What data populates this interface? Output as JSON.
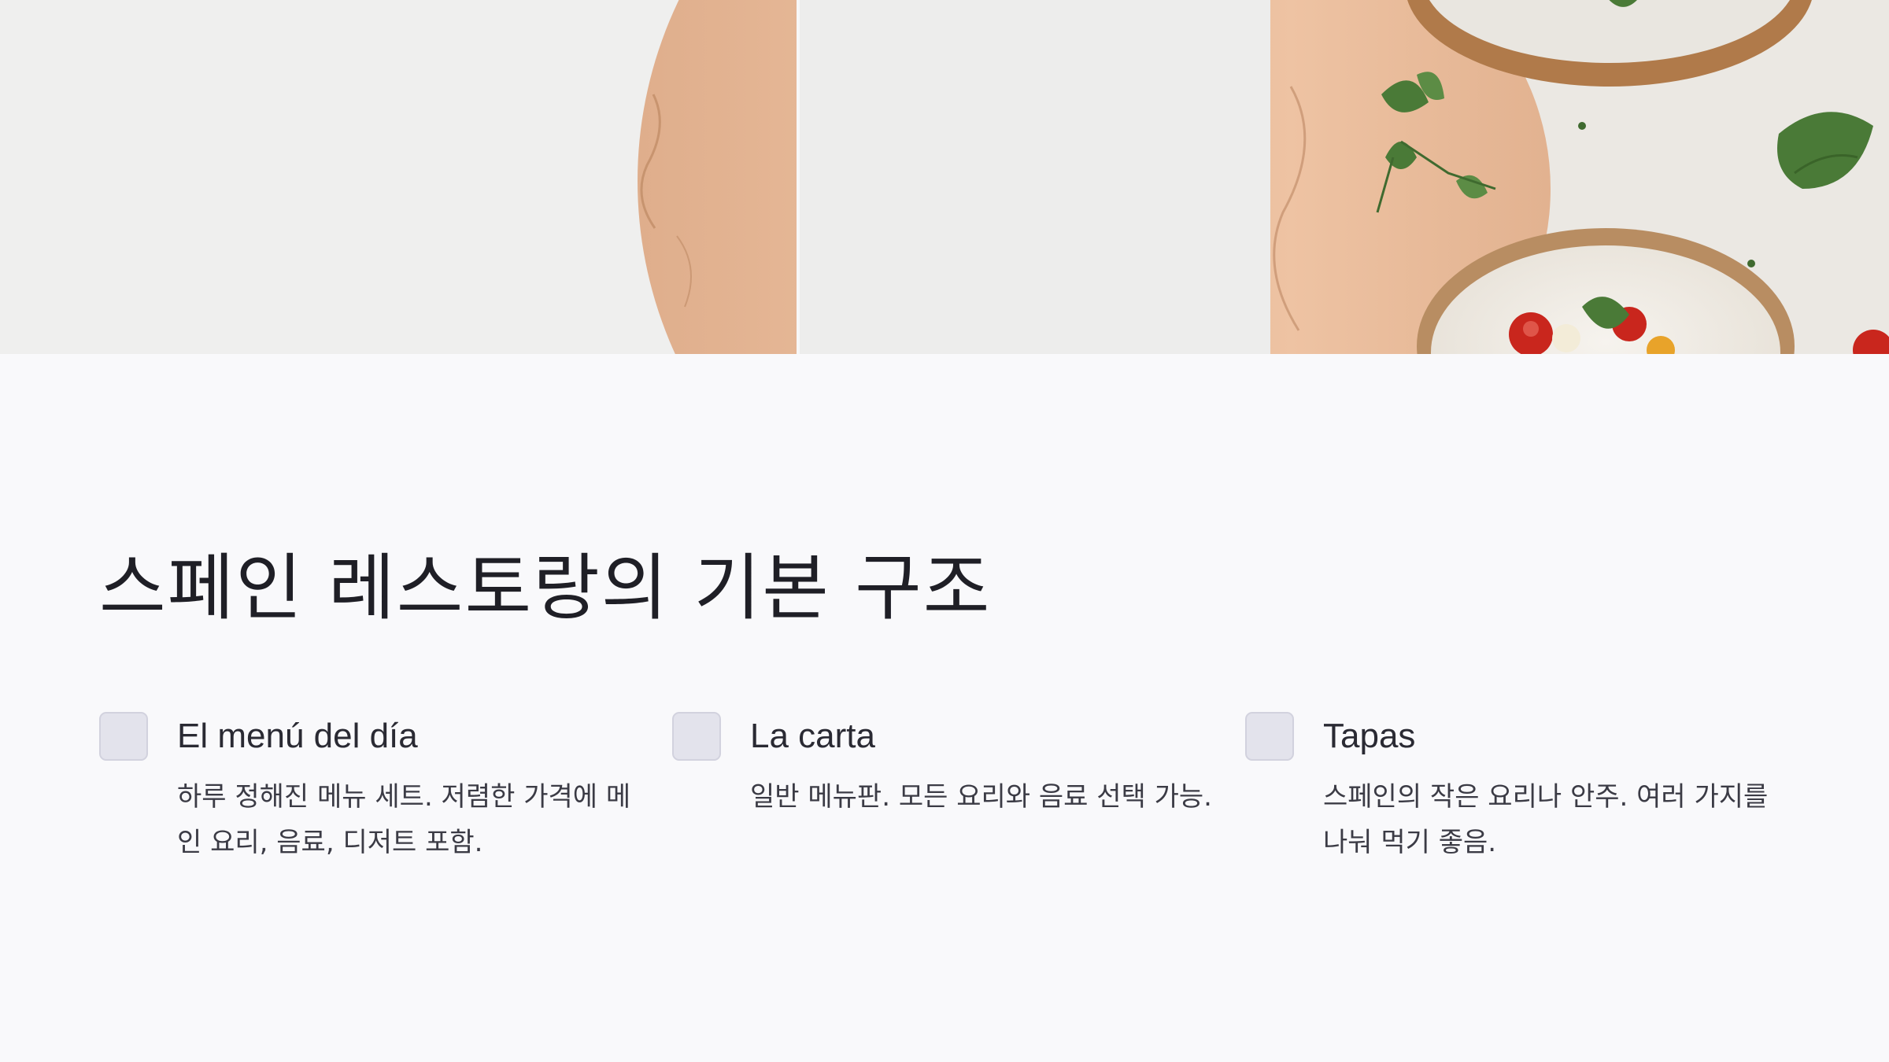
{
  "hero": {
    "description_hidden": ""
  },
  "title": "스페인 레스토랑의 기본 구조",
  "cards": [
    {
      "title": "El menú del día",
      "desc": "하루 정해진 메뉴 세트. 저렴한 가격에 메인 요리, 음료, 디저트 포함."
    },
    {
      "title": "La carta",
      "desc": "일반 메뉴판. 모든 요리와 음료 선택 가능."
    },
    {
      "title": "Tapas",
      "desc": "스페인의 작은 요리나 안주. 여러 가지를 나눠 먹기 좋음."
    }
  ],
  "colors": {
    "background": "#f9f9fb",
    "icon_bg": "#e3e3ec",
    "wood": "#e6b898",
    "plate": "#f1ede6",
    "leaf": "#4a7a37",
    "tomato": "#c9261d"
  }
}
